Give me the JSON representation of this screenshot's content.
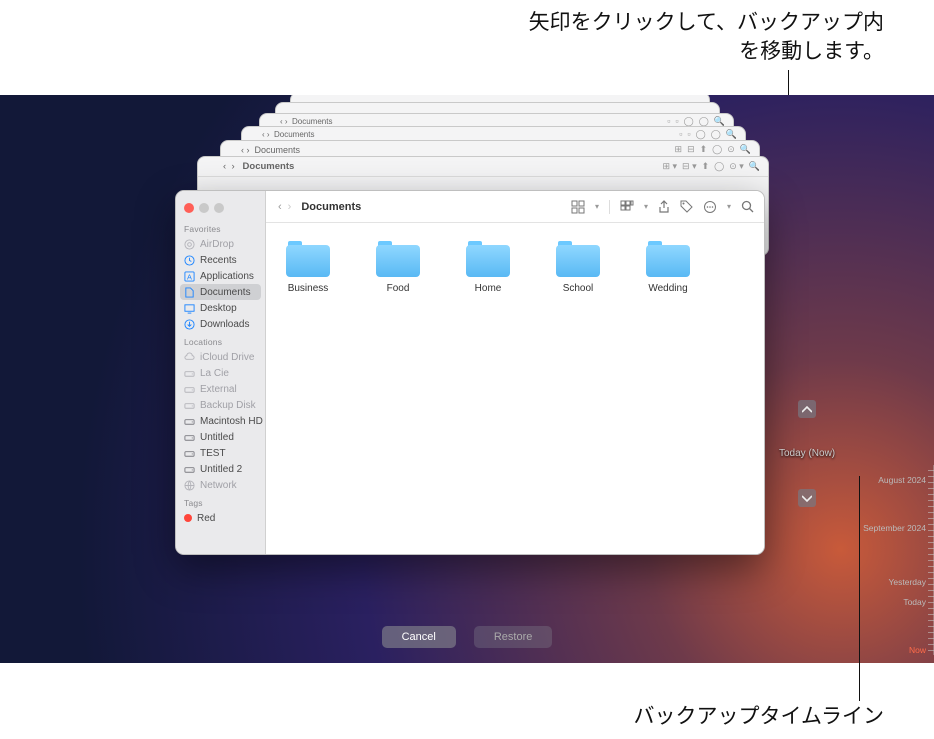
{
  "annotations": {
    "top": "矢印をクリックして、バックアップ内を移動します。",
    "bottom": "バックアップタイムライン"
  },
  "finder": {
    "title": "Documents",
    "ghost_title": "Documents",
    "sidebar": {
      "favorites_header": "Favorites",
      "locations_header": "Locations",
      "tags_header": "Tags",
      "favorites": [
        {
          "label": "AirDrop",
          "icon": "airdrop-icon",
          "dim": true
        },
        {
          "label": "Recents",
          "icon": "clock-icon",
          "dim": false
        },
        {
          "label": "Applications",
          "icon": "apps-icon",
          "dim": false
        },
        {
          "label": "Documents",
          "icon": "doc-icon",
          "dim": false,
          "selected": true
        },
        {
          "label": "Desktop",
          "icon": "desktop-icon",
          "dim": false
        },
        {
          "label": "Downloads",
          "icon": "download-icon",
          "dim": false
        }
      ],
      "locations": [
        {
          "label": "iCloud Drive",
          "icon": "cloud-icon",
          "dim": true
        },
        {
          "label": "La Cie",
          "icon": "disk-icon",
          "dim": true
        },
        {
          "label": "External",
          "icon": "disk-icon",
          "dim": true
        },
        {
          "label": "Backup Disk",
          "icon": "disk-icon",
          "dim": true
        },
        {
          "label": "Macintosh HD",
          "icon": "disk-icon",
          "dim": false
        },
        {
          "label": "Untitled",
          "icon": "disk-icon",
          "dim": false
        },
        {
          "label": "TEST",
          "icon": "disk-icon",
          "dim": false
        },
        {
          "label": "Untitled 2",
          "icon": "disk-icon",
          "dim": false
        },
        {
          "label": "Network",
          "icon": "globe-icon",
          "dim": true
        }
      ],
      "tags": [
        {
          "label": "Red",
          "color": "#ff453a"
        }
      ]
    },
    "folders": [
      {
        "name": "Business"
      },
      {
        "name": "Food"
      },
      {
        "name": "Home"
      },
      {
        "name": "School"
      },
      {
        "name": "Wedding"
      }
    ]
  },
  "navigation": {
    "current_label": "Today (Now)"
  },
  "timeline": {
    "items": [
      {
        "label": "August 2024",
        "pos": 10
      },
      {
        "label": "September 2024",
        "pos": 58
      },
      {
        "label": "Yesterday",
        "pos": 112
      },
      {
        "label": "Today",
        "pos": 132
      },
      {
        "label": "Now",
        "pos": 180,
        "now": true
      }
    ]
  },
  "buttons": {
    "cancel": "Cancel",
    "restore": "Restore"
  }
}
